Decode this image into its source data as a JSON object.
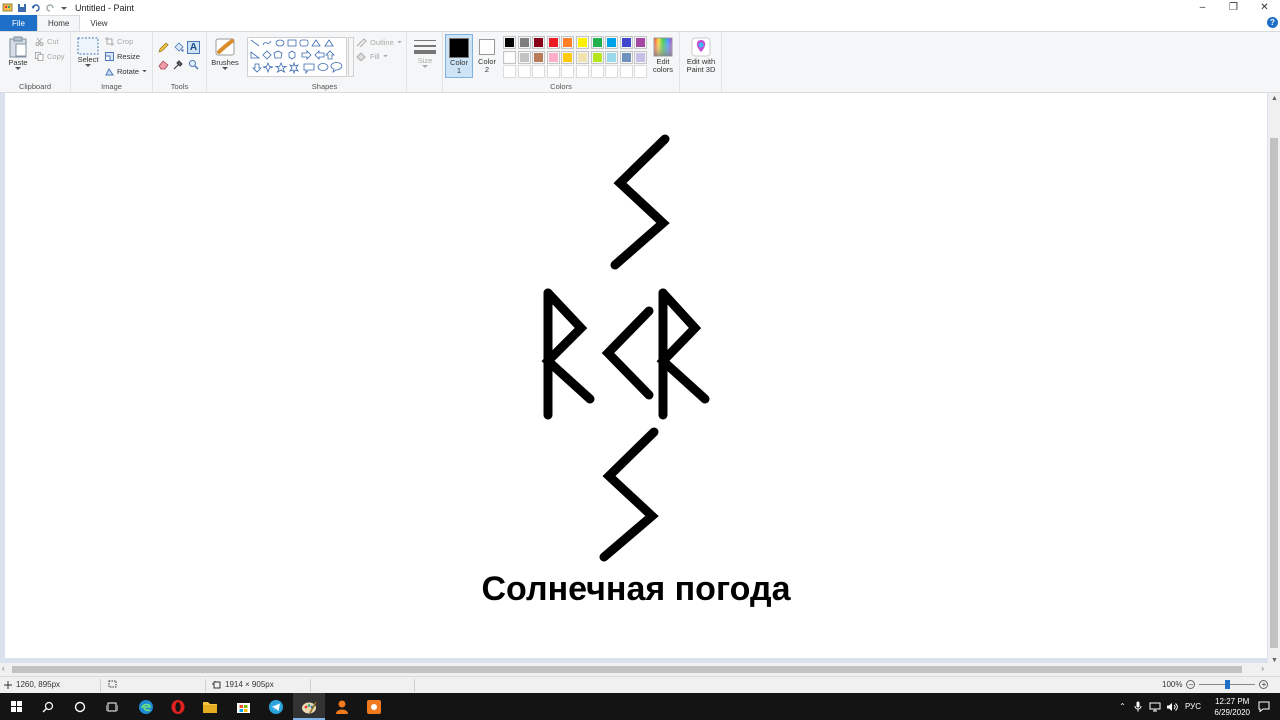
{
  "window": {
    "title": "Untitled - Paint"
  },
  "tabs": {
    "file": "File",
    "home": "Home",
    "view": "View"
  },
  "clipboard": {
    "paste": "Paste",
    "cut": "Cut",
    "copy": "Copy",
    "group_label": "Clipboard"
  },
  "image": {
    "select": "Select",
    "crop": "Crop",
    "resize": "Resize",
    "rotate": "Rotate",
    "group_label": "Image"
  },
  "tools": {
    "group_label": "Tools"
  },
  "brushes": {
    "label": "Brushes"
  },
  "shapes": {
    "outline": "Outline",
    "fill": "Fill",
    "group_label": "Shapes"
  },
  "size": {
    "label": "Size"
  },
  "colors": {
    "color1": "Color 1",
    "color2": "Color 2",
    "edit_colors": "Edit colors",
    "group_label": "Colors",
    "color1_value": "#000000",
    "color2_value": "#ffffff",
    "palette_row1": [
      "#000000",
      "#7f7f7f",
      "#880015",
      "#ed1c24",
      "#ff7f27",
      "#fff200",
      "#22b14c",
      "#00a2e8",
      "#3f48cc",
      "#a349a4"
    ],
    "palette_row2": [
      "#ffffff",
      "#c3c3c3",
      "#b97a57",
      "#ffaec9",
      "#ffc90e",
      "#efe4b0",
      "#b5e61d",
      "#99d9ea",
      "#7092be",
      "#c8bfe7"
    ]
  },
  "paint3d": {
    "label": "Edit with Paint 3D"
  },
  "canvas": {
    "caption": "Солнечная погода"
  },
  "statusbar": {
    "cursor_pos": "1260, 895px",
    "image_size": "1914 × 905px",
    "zoom": "100%"
  },
  "taskbar": {
    "language": "РУС",
    "time": "12:27 PM",
    "date": "6/29/2020"
  }
}
